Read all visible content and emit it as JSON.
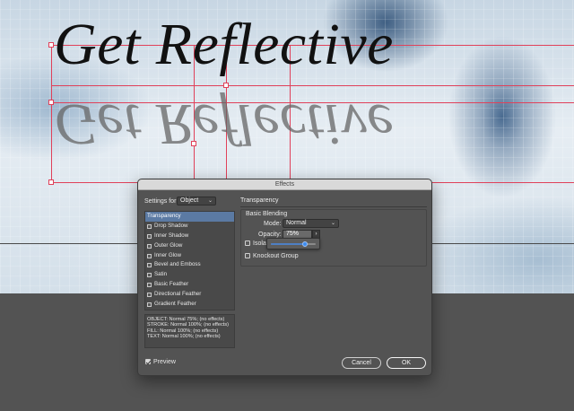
{
  "document": {
    "headline": "Get Reflective",
    "reflection_text": "Get Reflective"
  },
  "dialog": {
    "title": "Effects",
    "settings_for_label": "Settings for:",
    "settings_for_value": "Object",
    "effects_list": [
      {
        "label": "Transparency",
        "selected": true,
        "checkbox": false
      },
      {
        "label": "Drop Shadow",
        "selected": false,
        "checkbox": true
      },
      {
        "label": "Inner Shadow",
        "selected": false,
        "checkbox": true
      },
      {
        "label": "Outer Glow",
        "selected": false,
        "checkbox": true
      },
      {
        "label": "Inner Glow",
        "selected": false,
        "checkbox": true
      },
      {
        "label": "Bevel and Emboss",
        "selected": false,
        "checkbox": true
      },
      {
        "label": "Satin",
        "selected": false,
        "checkbox": true
      },
      {
        "label": "Basic Feather",
        "selected": false,
        "checkbox": true
      },
      {
        "label": "Directional Feather",
        "selected": false,
        "checkbox": true
      },
      {
        "label": "Gradient Feather",
        "selected": false,
        "checkbox": true
      }
    ],
    "summary_lines": [
      "OBJECT: Normal 75%; (no effects)",
      "STROKE: Normal 100%; (no effects)",
      "FILL: Normal 100%; (no effects)",
      "TEXT: Normal 100%; (no effects)"
    ],
    "section_title": "Transparency",
    "basic_blending_label": "Basic Blending",
    "mode_label": "Mode:",
    "mode_value": "Normal",
    "opacity_label": "Opacity:",
    "opacity_value": "75%",
    "opacity_slider_fraction": 0.75,
    "isolate_label": "Isolat",
    "knockout_label": "Knockout Group",
    "preview_label": "Preview",
    "preview_checked": true,
    "cancel_label": "Cancel",
    "ok_label": "OK",
    "accent_color": "#5b7aa3",
    "slider_color": "#3d8cf0"
  }
}
